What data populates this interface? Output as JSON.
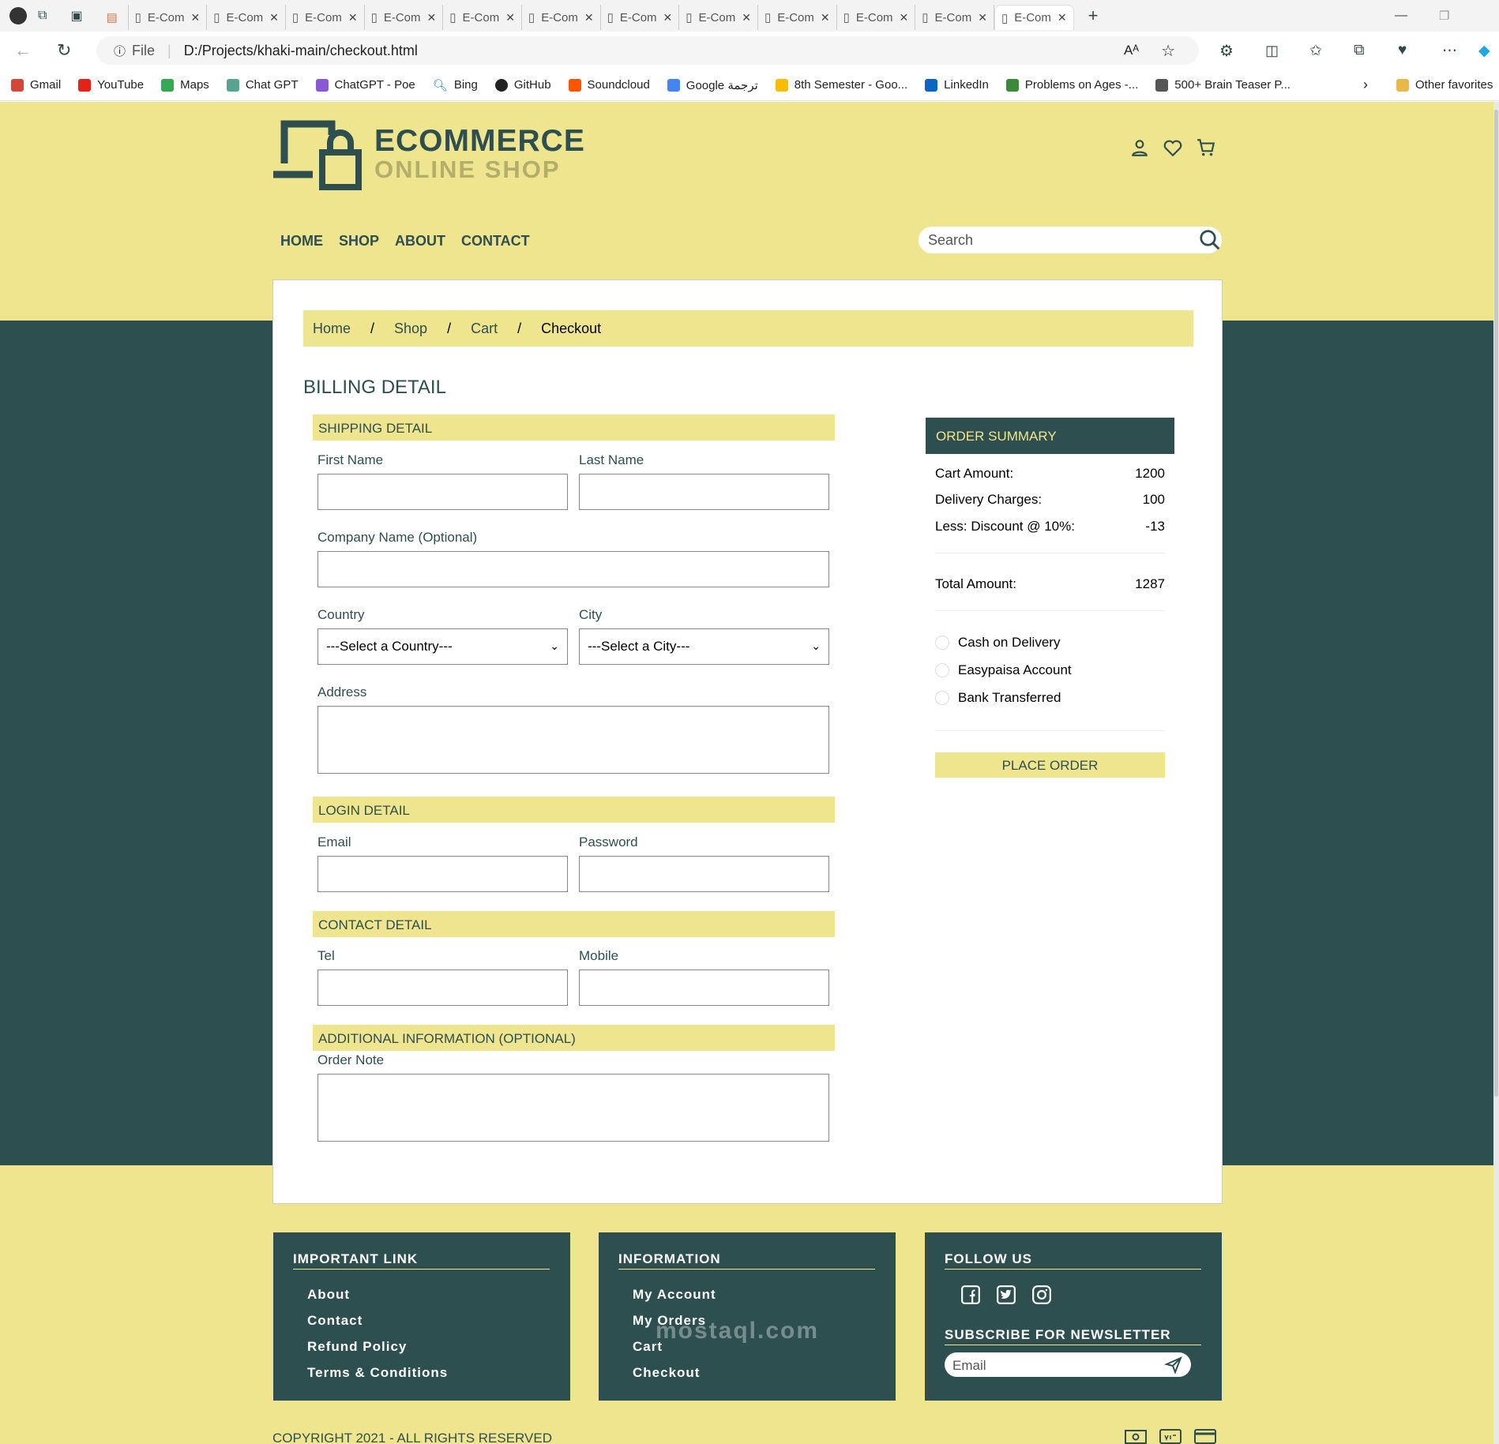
{
  "browser": {
    "tabs": [
      "E-Com",
      "E-Com",
      "E-Com",
      "E-Com",
      "E-Com",
      "E-Com",
      "E-Com",
      "E-Com",
      "E-Com",
      "E-Com",
      "E-Com",
      "E-Com"
    ],
    "active_tab": "E-Com",
    "url_scheme": "File",
    "url": "D:/Projects/khaki-main/checkout.html",
    "bookmarks": [
      "Gmail",
      "YouTube",
      "Maps",
      "Chat GPT",
      "ChatGPT - Poe",
      "Bing",
      "GitHub",
      "Soundcloud",
      "Google ترجمة",
      "8th Semester - Goo...",
      "LinkedIn",
      "Problems on Ages -...",
      "500+ Brain Teaser P..."
    ],
    "other_favorites": "Other favorites"
  },
  "header": {
    "logo_line1": "ECOMMERCE",
    "logo_line2": "ONLINE SHOP",
    "nav": [
      "HOME",
      "SHOP",
      "ABOUT",
      "CONTACT"
    ],
    "search_placeholder": "Search"
  },
  "breadcrumb": {
    "items": [
      "Home",
      "Shop",
      "Cart",
      "Checkout"
    ],
    "separator": "/"
  },
  "billing": {
    "title": "BILLING DETAIL",
    "shipping_title": "SHIPPING DETAIL",
    "first_name": "First Name",
    "last_name": "Last Name",
    "company": "Company Name (Optional)",
    "country": "Country",
    "country_select": "---Select a Country---",
    "city": "City",
    "city_select": "---Select a City---",
    "address": "Address",
    "login_title": "LOGIN DETAIL",
    "email": "Email",
    "password": "Password",
    "contact_title": "CONTACT DETAIL",
    "tel": "Tel",
    "mobile": "Mobile",
    "additional_title": "ADDITIONAL INFORMATION (OPTIONAL)",
    "order_note": "Order Note"
  },
  "summary": {
    "title": "ORDER SUMMARY",
    "cart_amount_label": "Cart Amount:",
    "cart_amount": "1200",
    "delivery_label": "Delivery Charges:",
    "delivery": "100",
    "discount_label": "Less: Discount @ 10%:",
    "discount": "-13",
    "total_label": "Total Amount:",
    "total": "1287",
    "payment_options": [
      "Cash on Delivery",
      "Easypaisa Account",
      "Bank Transferred"
    ],
    "place_order": "PLACE ORDER"
  },
  "footer": {
    "important_title": "IMPORTANT LINK",
    "important_links": [
      "About",
      "Contact",
      "Refund Policy",
      "Terms & Conditions"
    ],
    "information_title": "INFORMATION",
    "information_links": [
      "My Account",
      "My Orders",
      "Cart",
      "Checkout"
    ],
    "follow_title": "FOLLOW US",
    "newsletter_title": "SUBSCRIBE FOR NEWSLETTER",
    "email_placeholder": "Email",
    "copyright": "COPYRIGHT 2021 - ALL RIGHTS RESERVED",
    "watermark": "mostaql.com"
  },
  "colors": {
    "khaki": "#efe58e",
    "dark_teal": "#2e4f4f"
  }
}
